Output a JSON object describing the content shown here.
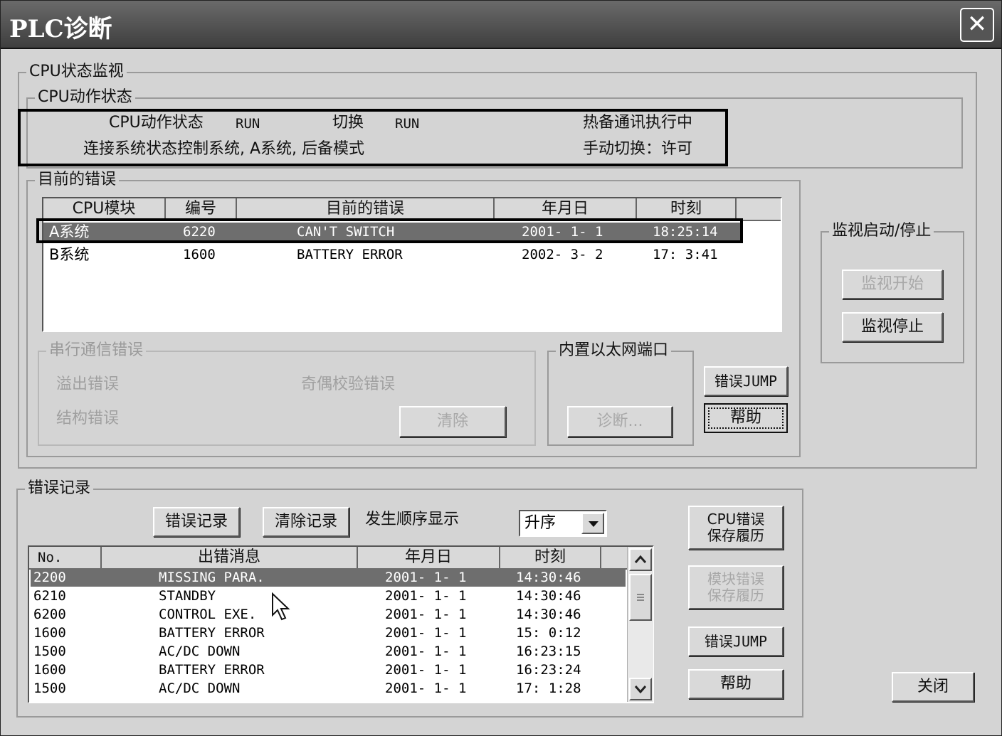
{
  "window": {
    "title": "PLC诊断",
    "close_glyph": "✕"
  },
  "cpu_monitor": {
    "group_label": "CPU状态监视",
    "action_group_label": "CPU动作状态",
    "action_state_label": "CPU动作状态",
    "action_state_value": "RUN",
    "switch_label": "切换",
    "switch_value": "RUN",
    "hot_standby": "热备通讯执行中",
    "connection_status": "连接系统状态控制系统, A系统, 后备模式",
    "manual_switch": "手动切换：许可"
  },
  "current_errors": {
    "group_label": "目前的错误",
    "columns": [
      "CPU模块",
      "编号",
      "目前的错误",
      "年月日",
      "时刻"
    ],
    "rows": [
      {
        "module": "A系统",
        "code": "6220",
        "message": "CAN'T SWITCH",
        "date": "2001- 1- 1",
        "time": "18:25:14",
        "selected": true
      },
      {
        "module": "B系统",
        "code": "1600",
        "message": "BATTERY ERROR",
        "date": "2002- 3- 2",
        "time": "17: 3:41",
        "selected": false
      }
    ]
  },
  "serial_errors": {
    "group_label": "串行通信错误",
    "overflow": "溢出错误",
    "parity": "奇偶校验错误",
    "structure": "结构错误",
    "clear_button": "清除"
  },
  "ethernet": {
    "group_label": "内置以太网端口",
    "diagnose_button": "诊断..."
  },
  "side_buttons": {
    "error_jump": "错误JUMP",
    "help": "帮助"
  },
  "monitor": {
    "group_label": "监视启动/停止",
    "start_button": "监视开始",
    "stop_button": "监视停止"
  },
  "error_log": {
    "group_label": "错误记录",
    "log_button": "错误记录",
    "clear_button": "清除记录",
    "order_label": "发生顺序显示",
    "order_value": "升序",
    "columns": [
      "No.",
      "出错消息",
      "年月日",
      "时刻"
    ],
    "rows": [
      {
        "no": "2200",
        "message": "MISSING PARA.",
        "date": "2001- 1- 1",
        "time": "14:30:46",
        "selected": true
      },
      {
        "no": "6210",
        "message": "STANDBY",
        "date": "2001- 1- 1",
        "time": "14:30:46",
        "selected": false
      },
      {
        "no": "6200",
        "message": "CONTROL EXE.",
        "date": "2001- 1- 1",
        "time": "14:30:46",
        "selected": false
      },
      {
        "no": "1600",
        "message": "BATTERY ERROR",
        "date": "2001- 1- 1",
        "time": "15: 0:12",
        "selected": false
      },
      {
        "no": "1500",
        "message": "AC/DC DOWN",
        "date": "2001- 1- 1",
        "time": "16:23:15",
        "selected": false
      },
      {
        "no": "1600",
        "message": "BATTERY ERROR",
        "date": "2001- 1- 1",
        "time": "16:23:24",
        "selected": false
      },
      {
        "no": "1500",
        "message": "AC/DC DOWN",
        "date": "2001- 1- 1",
        "time": "17: 1:28",
        "selected": false
      }
    ],
    "cpu_history_button": "CPU错误\n保存履历",
    "module_history_button": "模块错误\n保存履历",
    "error_jump_button": "错误JUMP",
    "help_button": "帮助"
  },
  "footer": {
    "close_button": "关闭"
  },
  "icons": {
    "close": "close-icon",
    "scroll_up": "chevron-up-icon",
    "scroll_down": "chevron-down-icon",
    "combo_arrow": "chevron-down-icon",
    "cursor": "mouse-pointer-icon"
  }
}
